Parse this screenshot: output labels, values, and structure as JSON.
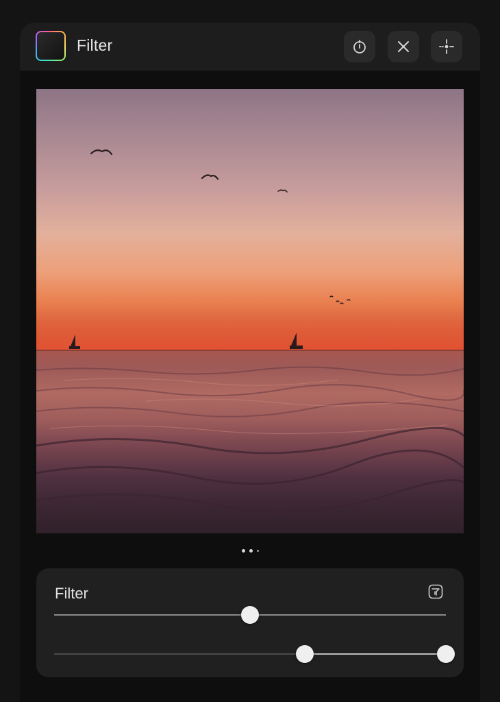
{
  "header": {
    "title": "Filter",
    "logo_icon": "app-logo-gradient-square",
    "buttons": [
      {
        "name": "timer-button",
        "icon": "timer-icon"
      },
      {
        "name": "close-button",
        "icon": "close-icon"
      },
      {
        "name": "crosshair-button",
        "icon": "crosshair-icon"
      }
    ]
  },
  "photo": {
    "subject": "sunset-over-sea"
  },
  "pager": {
    "pages": 3,
    "current": 1
  },
  "filter_panel": {
    "title": "Filter",
    "icon": "filter-icon",
    "slider_1": {
      "value": 0.5
    },
    "slider_2": {
      "low": 0.64,
      "high": 1.0
    }
  },
  "colors": {
    "background": "#141414",
    "surface": "#1d1d1d",
    "panel": "#202020",
    "button": "#2a2a2a",
    "text": "#e6e6e6",
    "thumb": "#efefef"
  }
}
